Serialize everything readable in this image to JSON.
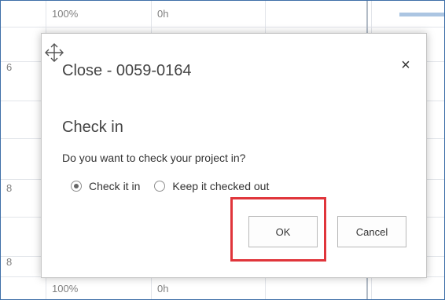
{
  "background": {
    "top_row": {
      "pct": "100%",
      "hours": "0h"
    },
    "bottom_row": {
      "pct": "100%",
      "hours": "0h"
    },
    "left_numbers": [
      "6",
      "8",
      "8"
    ]
  },
  "dialog": {
    "title": "Close - 0059-0164",
    "close_symbol": "×",
    "section_title": "Check in",
    "question": "Do you want to check your project in?",
    "options": [
      {
        "label": "Check it in",
        "selected": true
      },
      {
        "label": "Keep it checked out",
        "selected": false
      }
    ],
    "ok_label": "OK",
    "cancel_label": "Cancel"
  },
  "colors": {
    "highlight": "#e0353b",
    "frame": "#3f6fa8"
  },
  "icons": [
    "move-icon",
    "close-icon"
  ]
}
